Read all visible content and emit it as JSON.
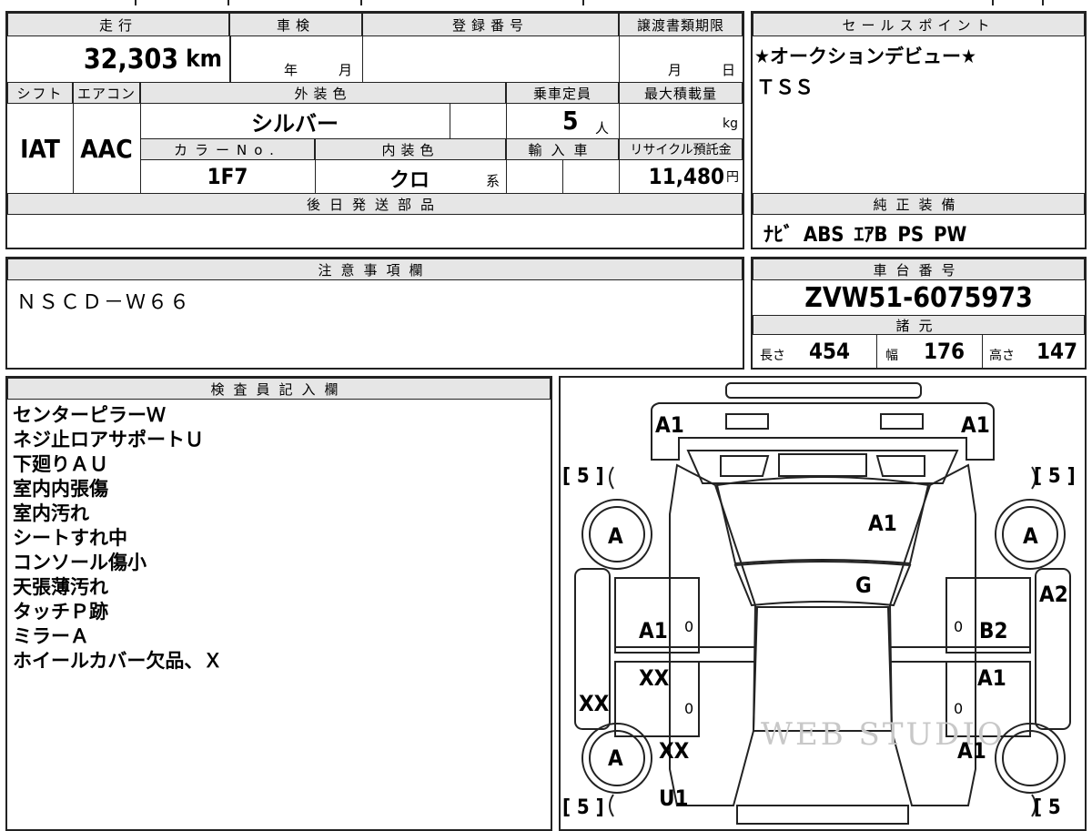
{
  "top": {
    "mileage_header": "走行",
    "mileage_value": "32,303",
    "mileage_unit": "km",
    "inspection_header": "車検",
    "inspection_year_unit": "年",
    "inspection_month_unit": "月",
    "registration_header": "登録番号",
    "transfer_header": "譲渡書類期限",
    "transfer_month_unit": "月",
    "transfer_day_unit": "日",
    "shift_header": "シフト",
    "aircon_header": "エアコン",
    "exterior_color_header": "外装色",
    "capacity_header": "乗車定員",
    "max_load_header": "最大積載量",
    "shift_value": "IAT",
    "aircon_value": "AAC",
    "exterior_color_value": "シルバー",
    "capacity_value": "5",
    "capacity_unit": "人",
    "max_load_unit": "kg",
    "color_no_header": "カラーNo.",
    "interior_color_header": "内装色",
    "import_header": "輸入車",
    "recycle_header": "リサイクル預託金",
    "color_no_value": "1F7",
    "interior_color_value": "クロ",
    "interior_color_suffix": "系",
    "recycle_value": "11,480",
    "recycle_unit": "円",
    "later_parts_header": "後日発送部品"
  },
  "sales": {
    "header": "セールスポイント",
    "line1": "★オークションデビュー★",
    "line2": "ＴＳＳ"
  },
  "equipment": {
    "header": "純正装備",
    "items": "ﾅﾋﾞ ABS ｴｱB PS PW"
  },
  "notes": {
    "header": "注意事項欄",
    "text": "ＮＳＣＤ－Ｗ６６"
  },
  "chassis": {
    "header": "車台番号",
    "value": "ZVW51-6075973",
    "specs_header": "諸元",
    "length_label": "長さ",
    "length_value": "454",
    "width_label": "幅",
    "width_value": "176",
    "height_label": "高さ",
    "height_value": "147"
  },
  "inspector": {
    "header": "検査員記入欄",
    "comments": [
      "センターピラーＷ",
      "ネジ止ロアサポートＵ",
      "下廻りＡＵ",
      "室内内張傷",
      "室内汚れ",
      "シートすれ中",
      "コンソール傷小",
      "天張薄汚れ",
      "タッチＰ跡",
      "ミラーＡ",
      "ホイールカバー欠品、Ｘ"
    ]
  },
  "diagram": {
    "tire_front_left": "[ 5 ]",
    "tire_front_right": "[ 5 ]",
    "tire_rear_left": "[ 5 ]",
    "tire_rear_right": "[ 5",
    "front_bumper_left": "A1",
    "front_bumper_right": "A1",
    "hood": "A1",
    "windshield": "G",
    "wheel_front_left": "A",
    "wheel_front_right": "A",
    "wheel_rear_left": "A",
    "front_door_left": "A1",
    "front_door_right": "B2",
    "fender_right": "A2",
    "rear_door_left": "XX",
    "rear_door_right": "A1",
    "sill_left": "XX",
    "quarter_left": "XX",
    "quarter_right": "A1",
    "rear_left": "U1",
    "mark_fl": "0",
    "mark_fr": "0",
    "mark_rl": "0",
    "mark_rr": "0",
    "watermark": "WEB STUDIO"
  }
}
